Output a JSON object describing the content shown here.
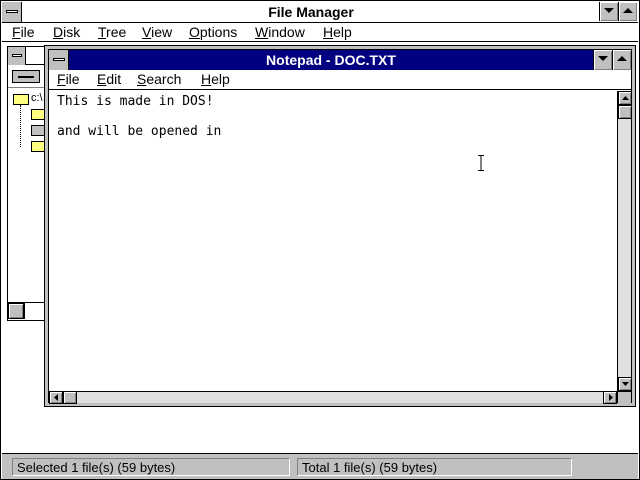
{
  "file_manager": {
    "title": "File Manager",
    "menu": [
      {
        "pre": "",
        "accel": "F",
        "post": "ile"
      },
      {
        "pre": "",
        "accel": "D",
        "post": "isk"
      },
      {
        "pre": "",
        "accel": "T",
        "post": "ree"
      },
      {
        "pre": "",
        "accel": "V",
        "post": "iew"
      },
      {
        "pre": "",
        "accel": "O",
        "post": "ptions"
      },
      {
        "pre": "",
        "accel": "W",
        "post": "indow"
      },
      {
        "pre": "",
        "accel": "H",
        "post": "elp"
      }
    ],
    "tree_root": "c:\\",
    "status": {
      "selected": "Selected 1 file(s) (59 bytes)",
      "total": "Total 1 file(s) (59 bytes)"
    }
  },
  "notepad": {
    "title": "Notepad - DOC.TXT",
    "menu": [
      {
        "pre": "",
        "accel": "F",
        "post": "ile"
      },
      {
        "pre": "",
        "accel": "E",
        "post": "dit"
      },
      {
        "pre": "",
        "accel": "S",
        "post": "earch"
      },
      {
        "pre": "",
        "accel": "H",
        "post": "elp"
      }
    ],
    "lines": [
      "This is made in DOS!",
      "",
      "and will be opened in"
    ]
  },
  "colors": {
    "active_title": "#000080",
    "chrome": "#c0c0c0",
    "folder": "#ffff80"
  }
}
